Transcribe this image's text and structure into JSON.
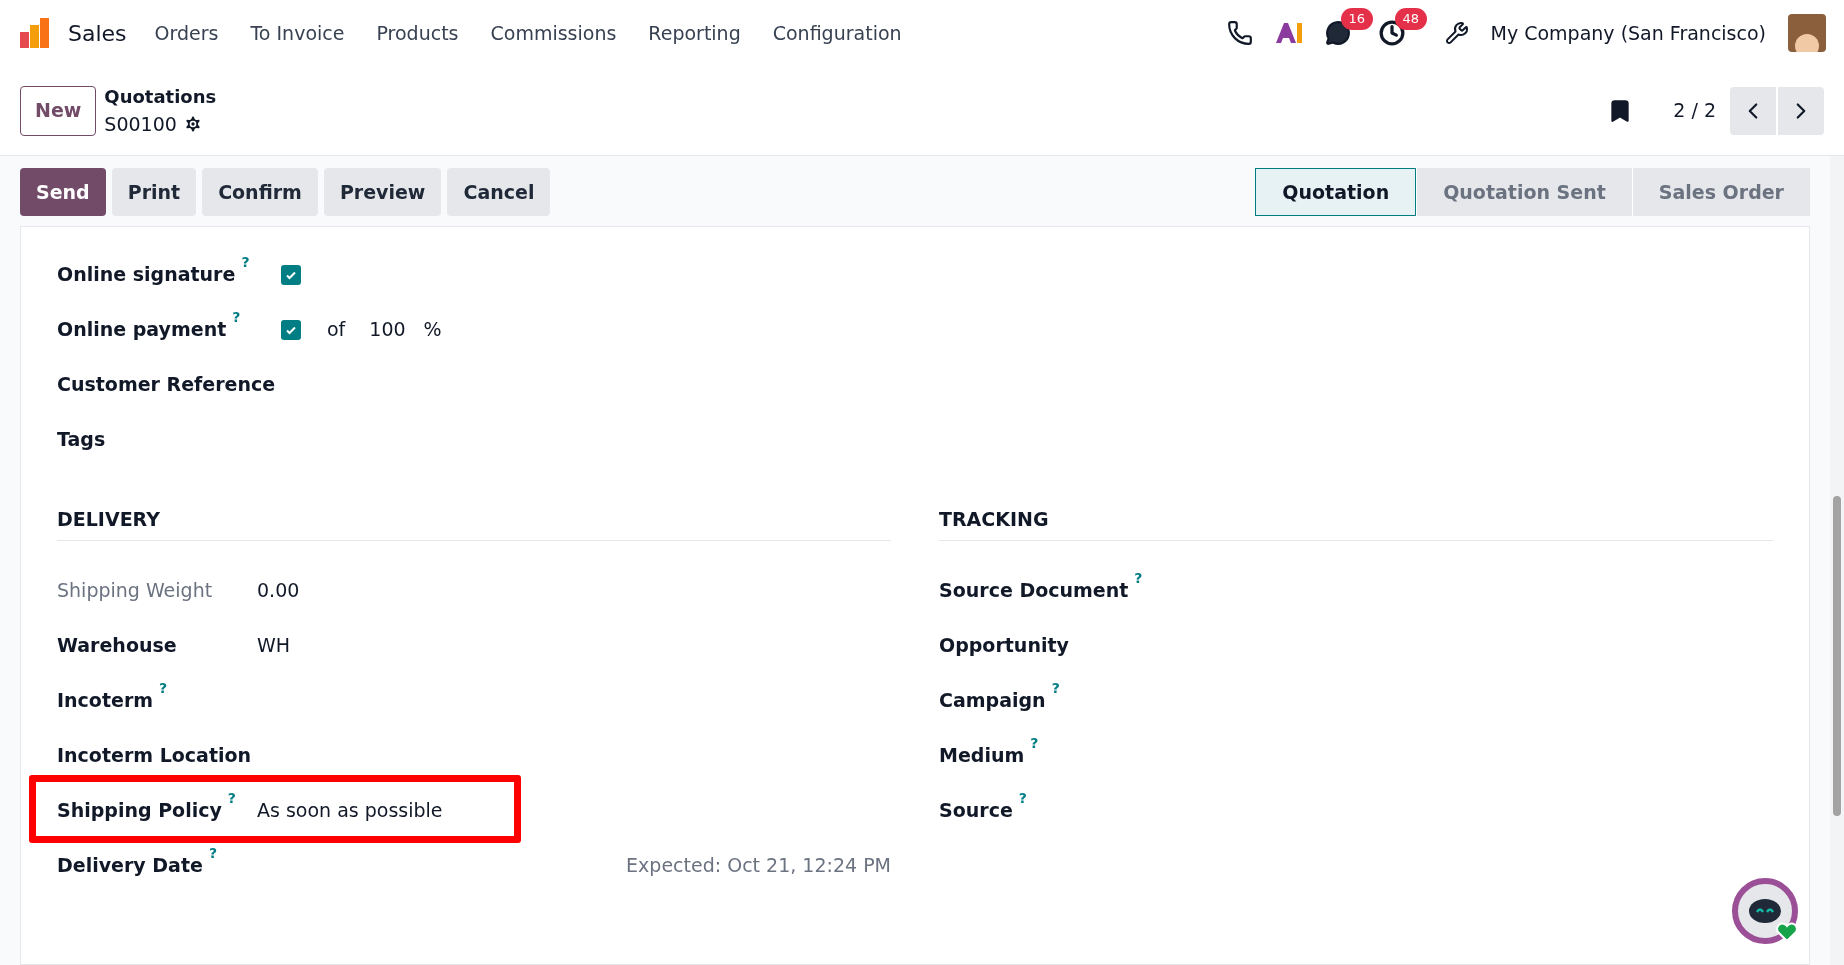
{
  "nav": {
    "app_name": "Sales",
    "menu": [
      "Orders",
      "To Invoice",
      "Products",
      "Commissions",
      "Reporting",
      "Configuration"
    ],
    "chat_count": "16",
    "activity_count": "48",
    "company": "My Company (San Francisco)"
  },
  "control": {
    "new_button": "New",
    "breadcrumb": "Quotations",
    "record": "S00100",
    "pager": "2 / 2"
  },
  "actions": [
    {
      "label": "Send",
      "primary": true
    },
    {
      "label": "Print",
      "primary": false
    },
    {
      "label": "Confirm",
      "primary": false
    },
    {
      "label": "Preview",
      "primary": false
    },
    {
      "label": "Cancel",
      "primary": false
    }
  ],
  "stages": [
    {
      "label": "Quotation",
      "selected": true
    },
    {
      "label": "Quotation Sent",
      "selected": false
    },
    {
      "label": "Sales Order",
      "selected": false
    }
  ],
  "upper_fields": [
    {
      "kind": "checkbox",
      "label": "Online signature",
      "help": "?",
      "checked": true
    },
    {
      "kind": "percent",
      "label": "Online payment",
      "help": "?",
      "checked": true,
      "prefix": "of",
      "value": "100",
      "suffix": "%"
    },
    {
      "kind": "text",
      "label": "Customer Reference"
    },
    {
      "kind": "text",
      "label": "Tags"
    }
  ],
  "delivery": {
    "title": "DELIVERY",
    "fields": [
      {
        "label": "Shipping Weight",
        "value": "0.00",
        "muted": true,
        "highlighted": false
      },
      {
        "label": "Warehouse",
        "value": "WH",
        "muted": false,
        "highlighted": false
      },
      {
        "label": "Incoterm",
        "help": "?",
        "muted": false,
        "highlighted": false
      },
      {
        "label": "Incoterm Location",
        "muted": false,
        "highlighted": false
      },
      {
        "label": "Shipping Policy",
        "help": "?",
        "value": "As soon as possible",
        "muted": false,
        "highlighted": true
      },
      {
        "label": "Delivery Date",
        "help": "?",
        "note": "Expected: Oct 21, 12:24 PM",
        "muted": false,
        "highlighted": false
      }
    ]
  },
  "tracking": {
    "title": "TRACKING",
    "fields": [
      {
        "label": "Source Document",
        "help": "?"
      },
      {
        "label": "Opportunity"
      },
      {
        "label": "Campaign",
        "help": "?"
      },
      {
        "label": "Medium",
        "help": "?"
      },
      {
        "label": "Source",
        "help": "?"
      }
    ]
  }
}
